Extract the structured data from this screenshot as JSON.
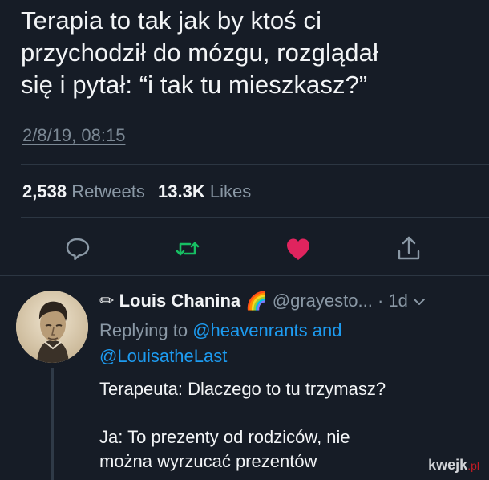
{
  "tweet": {
    "text_lines": [
      "Terapia to tak jak by ktoś ci",
      "przychodził do mózgu, rozglądał",
      "się i pytał: “i tak tu mieszkasz?”"
    ],
    "timestamp": "2/8/19, 08:15",
    "retweets_count": "2,538",
    "retweets_label": "Retweets",
    "likes_count": "13.3K",
    "likes_label": "Likes",
    "colors": {
      "retweet": "#17bf63",
      "like": "#e0245e",
      "icon_gray": "#8a98a5"
    }
  },
  "reply": {
    "name_prefix": "✏",
    "name": "Louis Chanina",
    "emoji": "🌈",
    "handle": "@grayesto...",
    "time": "· 1d",
    "replying_prefix": "Replying to",
    "mention_1": "@heavenrants",
    "and_word": "and",
    "mention_2": "@LouisatheLast",
    "body_line_1": "Terapeuta: Dlaczego to tu trzymasz?",
    "body_line_2": "Ja: To prezenty od rodziców, nie",
    "body_line_3": "można wyrzucać prezentów"
  },
  "watermark": {
    "brand": "kwejk",
    "tld": ".pl"
  }
}
